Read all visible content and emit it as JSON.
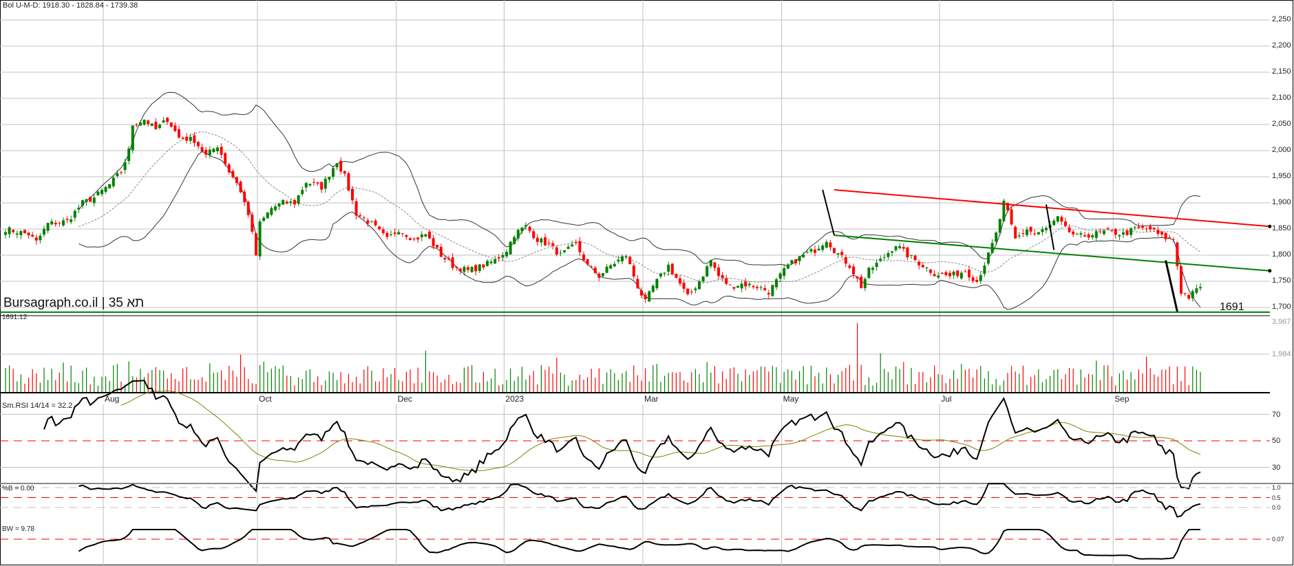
{
  "header": {
    "bollinger_label": "Bol U-M-D: 1918.30 - 1828.84 - 1739.38"
  },
  "watermark": "Bursagraph.co.il | תא 35",
  "support": {
    "label": "1691",
    "low_label": "1691.12",
    "value": 1691
  },
  "volume": {
    "max_label": "3,967",
    "mid_label": "1,984",
    "max": 3967
  },
  "rsi": {
    "label": "Sm.RSI 14/14 = 32.2",
    "ticks": [
      "70",
      "50",
      "30"
    ]
  },
  "percent_b": {
    "label": "%B = 0.00",
    "ticks": [
      "1.0",
      "0.5",
      "0.0"
    ]
  },
  "bandwidth": {
    "label": "BW = 9.78",
    "ticks": [
      "0.07"
    ]
  },
  "colors": {
    "up": "#008000",
    "down": "#ff0000",
    "grid": "#c0c0c0",
    "signal": "#808000"
  },
  "chart_data": {
    "type": "candlestick",
    "title": "TA-35 Daily",
    "ylim": [
      1690,
      2250
    ],
    "yticks": [
      "2,250",
      "2,200",
      "2,150",
      "2,100",
      "2,050",
      "2,000",
      "1,950",
      "1,900",
      "1,850",
      "1,800",
      "1,750",
      "1,700"
    ],
    "ytick_values": [
      2250,
      2200,
      2150,
      2100,
      2050,
      2000,
      1950,
      1900,
      1850,
      1800,
      1750,
      1700
    ],
    "months": [
      {
        "label": "Aug",
        "day": 25
      },
      {
        "label": "Oct",
        "day": 65
      },
      {
        "label": "Dec",
        "day": 101
      },
      {
        "label": "2023",
        "day": 129
      },
      {
        "label": "Mar",
        "day": 165
      },
      {
        "label": "May",
        "day": 201
      },
      {
        "label": "Jul",
        "day": 242
      },
      {
        "label": "Sep",
        "day": 287
      }
    ],
    "total_days": 311,
    "close_keypoints": [
      [
        0,
        1850
      ],
      [
        6,
        1840
      ],
      [
        8,
        1825
      ],
      [
        11,
        1860
      ],
      [
        16,
        1865
      ],
      [
        20,
        1900
      ],
      [
        23,
        1910
      ],
      [
        27,
        1935
      ],
      [
        30,
        1960
      ],
      [
        32,
        2000
      ],
      [
        33,
        2050
      ],
      [
        36,
        2060
      ],
      [
        39,
        2040
      ],
      [
        42,
        2060
      ],
      [
        45,
        2025
      ],
      [
        49,
        2020
      ],
      [
        52,
        1990
      ],
      [
        55,
        2010
      ],
      [
        58,
        1960
      ],
      [
        60,
        1940
      ],
      [
        63,
        1880
      ],
      [
        65,
        1800
      ],
      [
        66,
        1860
      ],
      [
        69,
        1890
      ],
      [
        72,
        1900
      ],
      [
        75,
        1900
      ],
      [
        78,
        1940
      ],
      [
        82,
        1930
      ],
      [
        86,
        1980
      ],
      [
        88,
        1950
      ],
      [
        91,
        1880
      ],
      [
        95,
        1860
      ],
      [
        99,
        1830
      ],
      [
        102,
        1850
      ],
      [
        106,
        1830
      ],
      [
        109,
        1840
      ],
      [
        113,
        1800
      ],
      [
        116,
        1780
      ],
      [
        120,
        1770
      ],
      [
        124,
        1780
      ],
      [
        127,
        1790
      ],
      [
        130,
        1810
      ],
      [
        132,
        1840
      ],
      [
        135,
        1855
      ],
      [
        138,
        1830
      ],
      [
        141,
        1820
      ],
      [
        144,
        1800
      ],
      [
        148,
        1820
      ],
      [
        151,
        1780
      ],
      [
        154,
        1760
      ],
      [
        157,
        1780
      ],
      [
        161,
        1800
      ],
      [
        164,
        1740
      ],
      [
        166,
        1710
      ],
      [
        168,
        1740
      ],
      [
        172,
        1780
      ],
      [
        175,
        1745
      ],
      [
        177,
        1720
      ],
      [
        180,
        1750
      ],
      [
        183,
        1790
      ],
      [
        185,
        1760
      ],
      [
        188,
        1740
      ],
      [
        191,
        1745
      ],
      [
        195,
        1740
      ],
      [
        198,
        1730
      ],
      [
        200,
        1750
      ],
      [
        203,
        1780
      ],
      [
        207,
        1800
      ],
      [
        210,
        1810
      ],
      [
        213,
        1830
      ],
      [
        215,
        1810
      ],
      [
        219,
        1780
      ],
      [
        222,
        1740
      ],
      [
        224,
        1770
      ],
      [
        227,
        1790
      ],
      [
        231,
        1820
      ],
      [
        234,
        1800
      ],
      [
        238,
        1780
      ],
      [
        241,
        1765
      ],
      [
        245,
        1760
      ],
      [
        249,
        1770
      ],
      [
        252,
        1750
      ],
      [
        255,
        1800
      ],
      [
        257,
        1840
      ],
      [
        259,
        1900
      ],
      [
        260,
        1880
      ],
      [
        262,
        1830
      ],
      [
        265,
        1850
      ],
      [
        267,
        1840
      ],
      [
        270,
        1850
      ],
      [
        273,
        1870
      ],
      [
        275,
        1850
      ],
      [
        278,
        1835
      ],
      [
        282,
        1840
      ],
      [
        286,
        1845
      ],
      [
        290,
        1840
      ],
      [
        293,
        1850
      ],
      [
        297,
        1850
      ],
      [
        300,
        1835
      ],
      [
        303,
        1830
      ],
      [
        305,
        1730
      ],
      [
        307,
        1720
      ],
      [
        310,
        1739
      ]
    ],
    "trendlines": [
      {
        "name": "resistance",
        "color": "#ff0000",
        "from": [
          215,
          1925
        ],
        "to": [
          328,
          1855
        ]
      },
      {
        "name": "support-channel",
        "color": "#008000",
        "from": [
          215,
          1838
        ],
        "to": [
          328,
          1770
        ]
      }
    ],
    "bollinger": {
      "period": 20,
      "stddev": 2,
      "upper": 1918.3,
      "middle": 1828.84,
      "lower": 1739.38
    }
  }
}
